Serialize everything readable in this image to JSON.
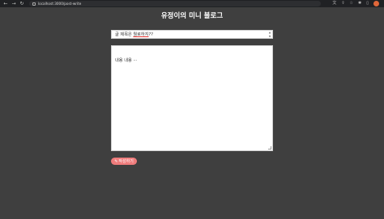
{
  "browser": {
    "back_icon": "arrow-left-icon",
    "forward_icon": "arrow-right-icon",
    "reload_icon": "reload-icon",
    "url": "localhost:3000/post-write",
    "tools": [
      "translate-icon",
      "share-icon",
      "bookmark-icon",
      "extensions-icon",
      "sidebar-icon"
    ]
  },
  "page": {
    "title": "유정이의 미니 블로그"
  },
  "form": {
    "title_placeholder_prefix": "글 제목은 ",
    "title_placeholder_underlined": "뭘로하지",
    "title_placeholder_suffix": "??",
    "content_placeholder": "내용 내용 ···",
    "submit_label": "작성하기",
    "submit_icon": "pencil-icon"
  },
  "colors": {
    "background": "#3f3f3f",
    "button": "#ef7c7c",
    "browser_bar": "#202124"
  }
}
